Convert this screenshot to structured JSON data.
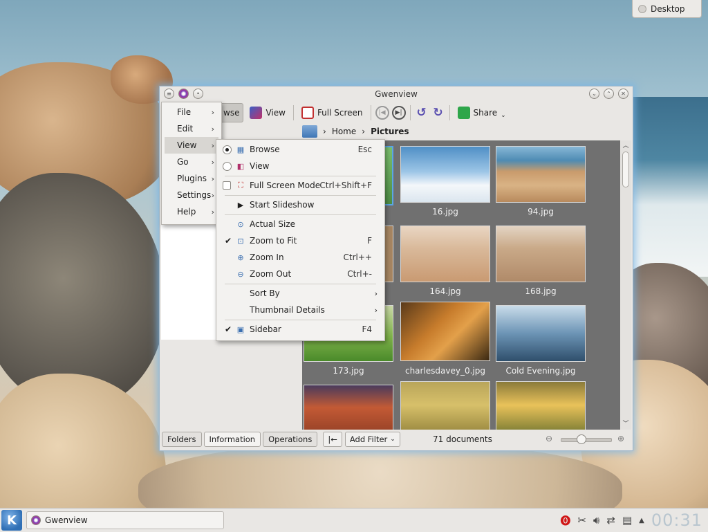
{
  "desktop": {
    "widget_label": "Desktop"
  },
  "window": {
    "title": "Gwenview",
    "toolbar": {
      "browse_label": "wse",
      "view_label": "View",
      "fullscreen_label": "Full Screen",
      "share_label": "Share"
    },
    "breadcrumb": {
      "home": "Home",
      "current": "Pictures"
    },
    "thumbnails": [
      {
        "label": "16.jpg"
      },
      {
        "label": "94.jpg"
      },
      {
        "label": "164.jpg"
      },
      {
        "label": "168.jpg"
      },
      {
        "label": "173.jpg"
      },
      {
        "label": "charlesdavey_0.jpg"
      },
      {
        "label": "Cold Evening.jpg"
      }
    ],
    "bottom": {
      "tabs": [
        "Folders",
        "Information",
        "Operations"
      ],
      "add_filter": "Add Filter",
      "status": "71 documents"
    }
  },
  "menubar_menu": {
    "items": [
      "File",
      "Edit",
      "View",
      "Go",
      "Plugins",
      "Settings",
      "Help"
    ]
  },
  "view_menu": {
    "items": [
      {
        "label": "Browse",
        "shortcut": "Esc"
      },
      {
        "label": "View",
        "shortcut": ""
      },
      {
        "label": "Full Screen Mode",
        "shortcut": "Ctrl+Shift+F"
      },
      {
        "label": "Start Slideshow",
        "shortcut": ""
      },
      {
        "label": "Actual Size",
        "shortcut": ""
      },
      {
        "label": "Zoom to Fit",
        "shortcut": "F"
      },
      {
        "label": "Zoom In",
        "shortcut": "Ctrl++"
      },
      {
        "label": "Zoom Out",
        "shortcut": "Ctrl+-"
      },
      {
        "label": "Sort By",
        "shortcut": ""
      },
      {
        "label": "Thumbnail Details",
        "shortcut": ""
      },
      {
        "label": "Sidebar",
        "shortcut": "F4"
      }
    ]
  },
  "taskbar": {
    "task_label": "Gwenview",
    "clock": "00:31"
  },
  "colors": {
    "accent": "#3b7bc0",
    "grid_bg": "#707070",
    "window_glow": "#78b4e6"
  }
}
